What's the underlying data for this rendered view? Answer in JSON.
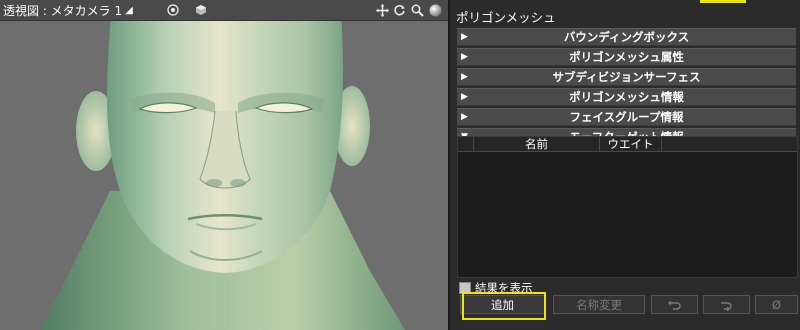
{
  "viewport": {
    "title": "透視図 : メタカメラ 1",
    "icons": [
      "target-icon",
      "cube-icon",
      "move-icon",
      "rotate-icon",
      "zoom-icon",
      "sphere-icon"
    ],
    "background_color": "#6e6e6e"
  },
  "panel": {
    "title": "ポリゴンメッシュ",
    "accent_color": "#f0e600",
    "sections": [
      {
        "label": "バウンディングボックス",
        "expanded": false
      },
      {
        "label": "ポリゴンメッシュ属性",
        "expanded": false
      },
      {
        "label": "サブディビジョンサーフェス",
        "expanded": false
      },
      {
        "label": "ポリゴンメッシュ情報",
        "expanded": false
      },
      {
        "label": "フェイスグループ情報",
        "expanded": false
      },
      {
        "label": "モーフターゲット情報",
        "expanded": true
      }
    ],
    "table": {
      "columns": [
        "",
        "名前",
        "ウエイト",
        ""
      ],
      "rows": []
    },
    "show_result": {
      "label": "結果を表示",
      "checked": false
    },
    "buttons": {
      "add": "追加",
      "rename": "名称変更",
      "icon_buttons": [
        "undo-arrow-icon",
        "redo-arrow-icon",
        "clear-icon"
      ]
    }
  }
}
